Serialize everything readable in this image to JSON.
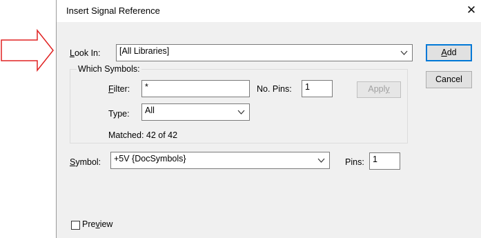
{
  "dialog": {
    "title": "Insert Signal Reference",
    "close_glyph": "✕"
  },
  "look_in": {
    "label_u": "L",
    "label_rest": "ook In:",
    "value": "[All Libraries]"
  },
  "which_symbols": {
    "group_title": "Which Symbols:",
    "filter": {
      "label_u": "F",
      "label_rest": "ilter:",
      "value": "*"
    },
    "no_pins": {
      "label": "No. Pins:",
      "value": "1"
    },
    "apply_button": {
      "label_pre": "Appl",
      "label_u": "y"
    },
    "type": {
      "label": "Type:",
      "value": "All"
    },
    "matched": "Matched: 42 of 42"
  },
  "symbol": {
    "label_u": "S",
    "label_rest": "ymbol:",
    "value": "+5V {DocSymbols}",
    "pins_label": "Pins:",
    "pins_value": "1"
  },
  "buttons": {
    "add": {
      "label_u": "A",
      "label_rest": "dd"
    },
    "cancel": "Cancel"
  },
  "preview": {
    "label_pre": "Pre",
    "label_u": "v",
    "label_rest": "iew",
    "checked": false
  },
  "colors": {
    "arrow": "#e02020",
    "accent": "#0078d7"
  },
  "icons": {
    "annotation_arrow": "right-arrow-icon",
    "dropdown": "chevron-down-icon",
    "close": "close-icon"
  }
}
